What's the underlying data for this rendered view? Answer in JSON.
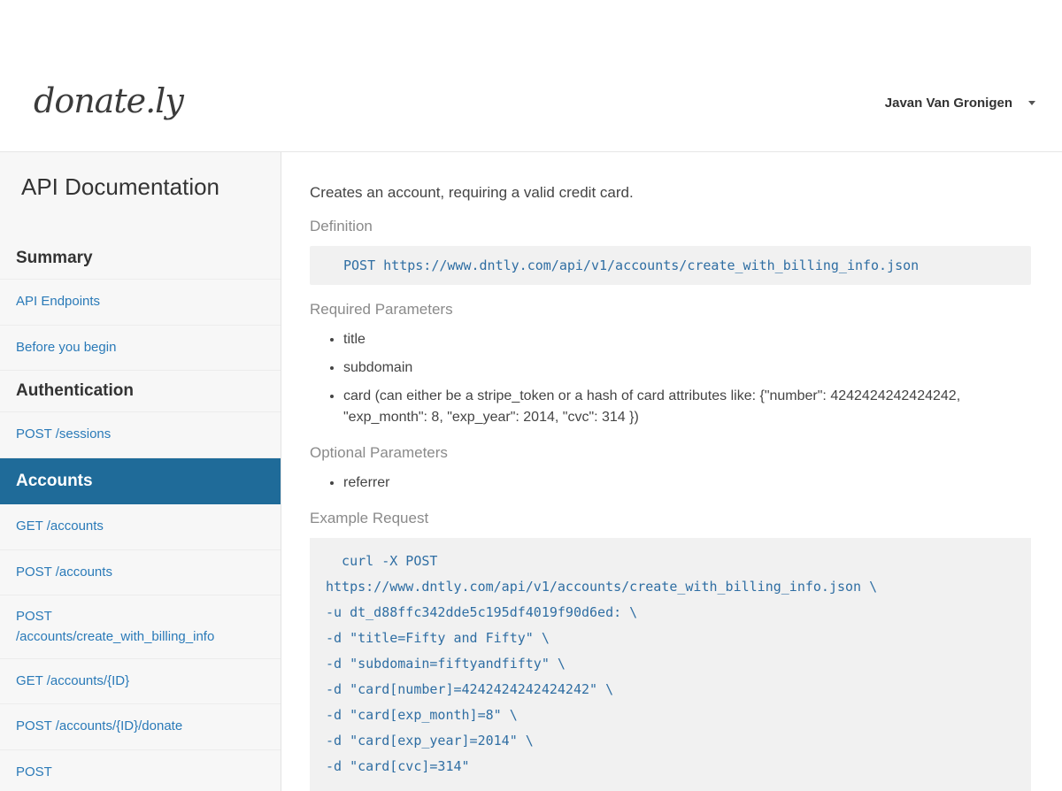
{
  "header": {
    "logo": "donate.ly",
    "user_name": "Javan Van Gronigen"
  },
  "sidebar": {
    "title": "API Documentation",
    "items": [
      {
        "type": "heading",
        "label": "Summary"
      },
      {
        "type": "link",
        "label": "API Endpoints"
      },
      {
        "type": "link",
        "label": "Before you begin"
      },
      {
        "type": "heading",
        "label": "Authentication"
      },
      {
        "type": "link",
        "label": "POST /sessions"
      },
      {
        "type": "active",
        "label": "Accounts"
      },
      {
        "type": "link",
        "label": "GET /accounts"
      },
      {
        "type": "link",
        "label": "POST /accounts"
      },
      {
        "type": "link",
        "label": "POST\n/accounts/create_with_billing_info"
      },
      {
        "type": "link",
        "label": "GET /accounts/{ID}"
      },
      {
        "type": "link",
        "label": "POST /accounts/{ID}/donate"
      },
      {
        "type": "link",
        "label": "POST"
      }
    ]
  },
  "main": {
    "lead": "Creates an account, requiring a valid credit card.",
    "definition_label": "Definition",
    "definition_code": "POST https://www.dntly.com/api/v1/accounts/create_with_billing_info.json",
    "required_label": "Required Parameters",
    "required_params": [
      "title",
      "subdomain",
      "card (can either be a stripe_token or a hash of card attributes like: {\"number\": 4242424242424242, \"exp_month\": 8, \"exp_year\": 2014, \"cvc\": 314 })"
    ],
    "optional_label": "Optional Parameters",
    "optional_params": [
      "referrer"
    ],
    "example_label": "Example Request",
    "example_code": "  curl -X POST\nhttps://www.dntly.com/api/v1/accounts/create_with_billing_info.json \\\n-u dt_d88ffc342dde5c195df4019f90d6ed: \\\n-d \"title=Fifty and Fifty\" \\\n-d \"subdomain=fiftyandfifty\" \\\n-d \"card[number]=4242424242424242\" \\\n-d \"card[exp_month]=8\" \\\n-d \"card[exp_year]=2014\" \\\n-d \"card[cvc]=314\""
  }
}
